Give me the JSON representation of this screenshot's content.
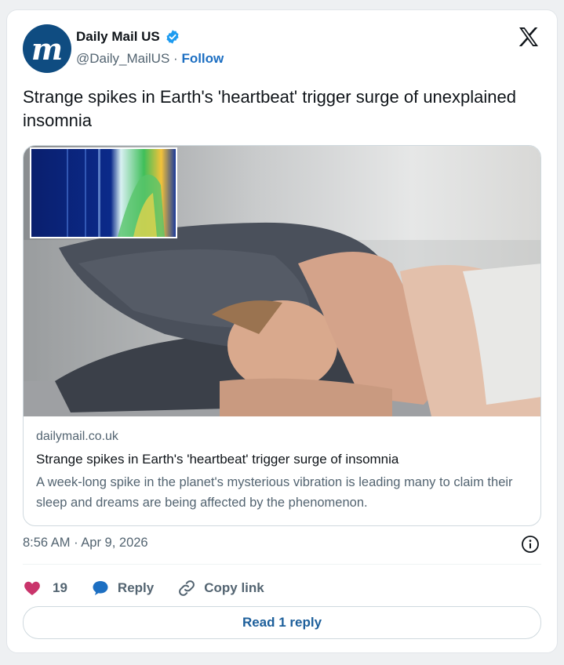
{
  "author": {
    "display_name": "Daily Mail US",
    "avatar_letter": "m",
    "handle": "@Daily_MailUS",
    "separator": "·",
    "follow_label": "Follow",
    "verified": true
  },
  "tweet": {
    "text": "Strange spikes in Earth's 'heartbeat' trigger surge of unexplained insomnia",
    "timestamp": "8:56 AM · Apr 9, 2026"
  },
  "link_card": {
    "domain": "dailymail.co.uk",
    "title": "Strange spikes in Earth's 'heartbeat' trigger surge of insomnia",
    "description": "A week-long spike in the planet's mysterious vibration is leading many to claim their sleep and dreams are being affected by the phenomenon.",
    "image_subject": "woman covering head with pillow in bed, spectrogram inset"
  },
  "actions": {
    "like_count": "19",
    "reply_label": "Reply",
    "copy_link_label": "Copy link"
  },
  "footer": {
    "read_replies_label": "Read 1 reply"
  },
  "colors": {
    "brand": "#0f4c81",
    "verified": "#1d9bf0",
    "heart": "#c9346b",
    "reply": "#1d6fc2"
  },
  "icons": [
    "verified-badge-icon",
    "x-logo-icon",
    "heart-icon",
    "reply-bubble-icon",
    "link-icon",
    "info-icon"
  ]
}
